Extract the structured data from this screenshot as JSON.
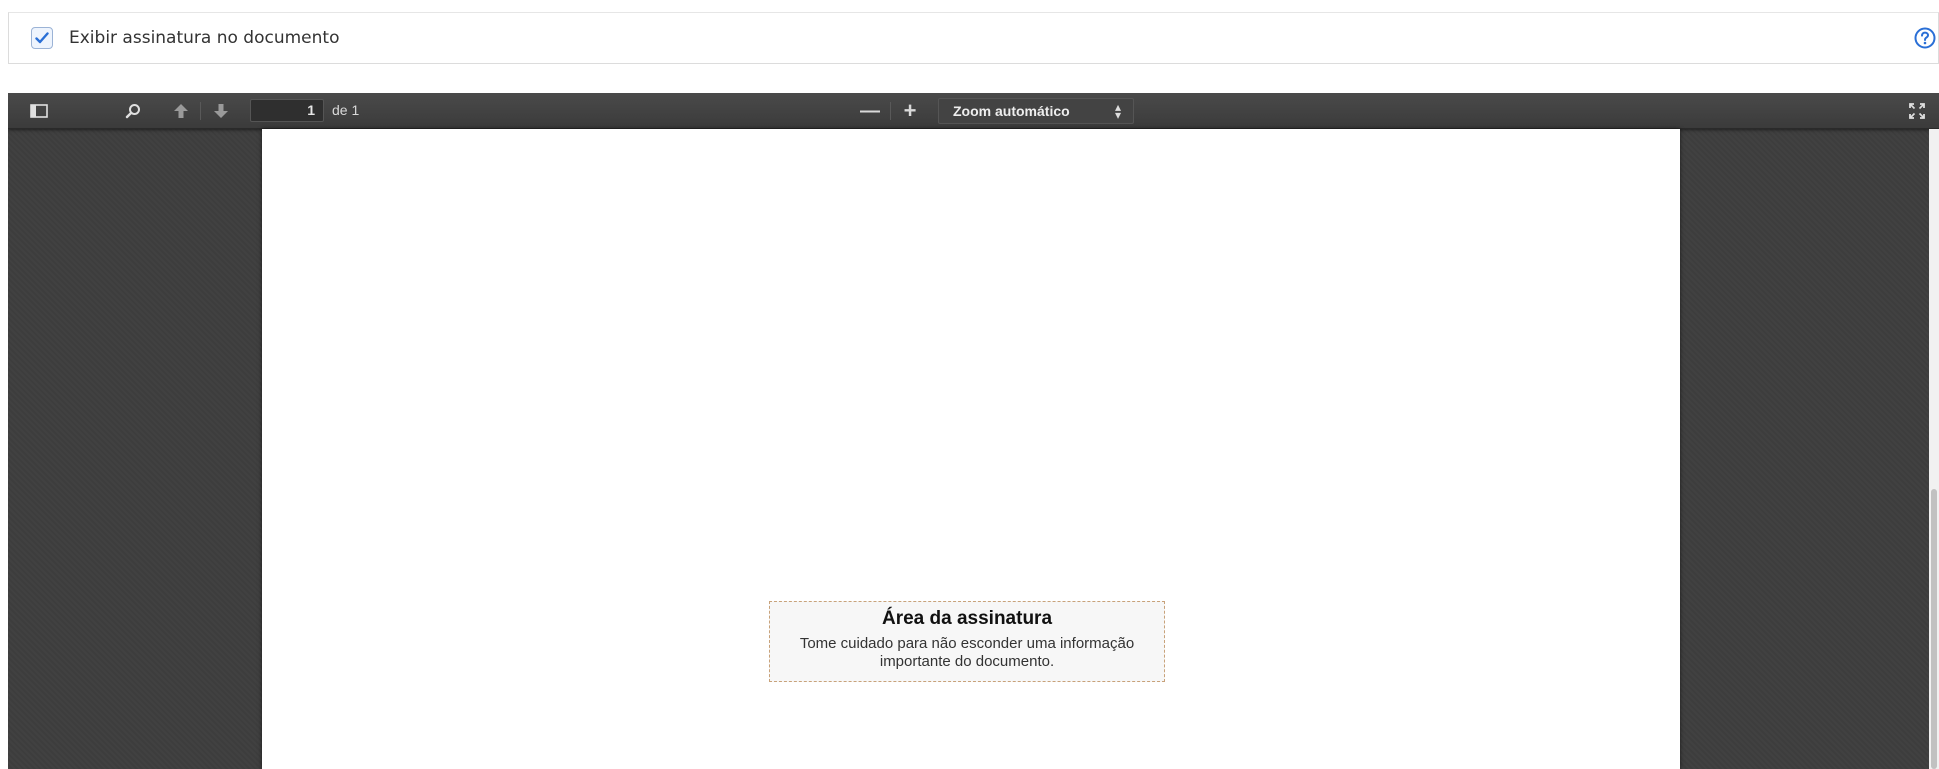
{
  "option": {
    "show_signature_label": "Exibir assinatura no documento",
    "show_signature_checked": true,
    "help_icon": "question-circle-icon"
  },
  "viewer": {
    "toolbar": {
      "sidebar_toggle_icon": "sidebar-toggle-icon",
      "search_icon": "search-icon",
      "prev_page_icon": "arrow-up-icon",
      "next_page_icon": "arrow-down-icon",
      "page_number": "1",
      "page_of": "de 1",
      "zoom_out_label": "—",
      "zoom_in_label": "+",
      "zoom_value": "Zoom automático",
      "fullscreen_icon": "fullscreen-icon"
    },
    "signature_area": {
      "title": "Área da assinatura",
      "message": "Tome cuidado para não esconder uma informação importante do documento."
    },
    "colors": {
      "background": "#3e3e3e",
      "toolbar": "#424242",
      "accent": "#2a6fd6"
    }
  }
}
